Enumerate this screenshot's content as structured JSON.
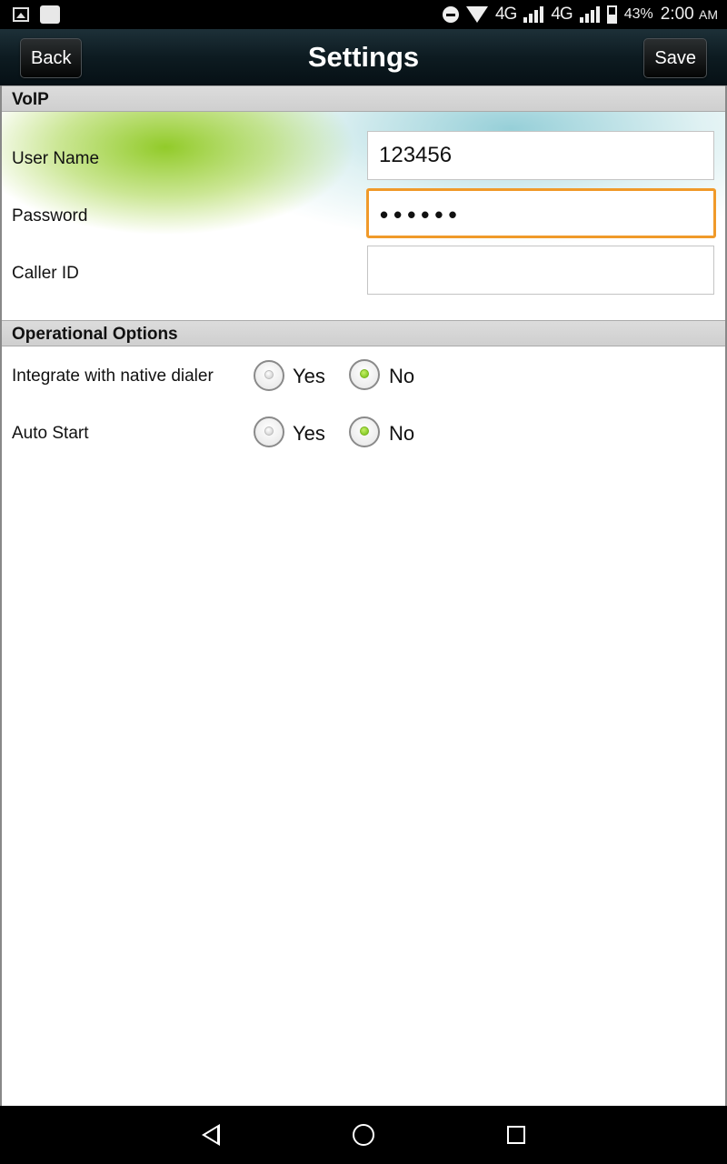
{
  "status_bar": {
    "network_1": "4G",
    "network_2": "4G",
    "battery": "43%",
    "time": "2:00",
    "ampm": "AM",
    "icons": [
      "image-icon",
      "square-app-icon",
      "do-not-disturb-icon",
      "wifi-icon",
      "signal-icon",
      "battery-icon"
    ]
  },
  "header": {
    "title": "Settings",
    "back_label": "Back",
    "save_label": "Save"
  },
  "voip": {
    "section_title": "VoIP",
    "user_name_label": "User Name",
    "user_name_value": "123456",
    "password_label": "Password",
    "password_value": "••••••",
    "caller_id_label": "Caller ID",
    "caller_id_value": ""
  },
  "operational": {
    "section_title": "Operational Options",
    "options": [
      {
        "label": "Integrate with native dialer",
        "yes": "Yes",
        "no": "No",
        "selected": "No"
      },
      {
        "label": "Auto Start",
        "yes": "Yes",
        "no": "No",
        "selected": "No"
      }
    ]
  },
  "colors": {
    "focus_border": "#f09a2a",
    "radio_selected": "#6fbd12",
    "header_bg": "#0d1b21"
  }
}
